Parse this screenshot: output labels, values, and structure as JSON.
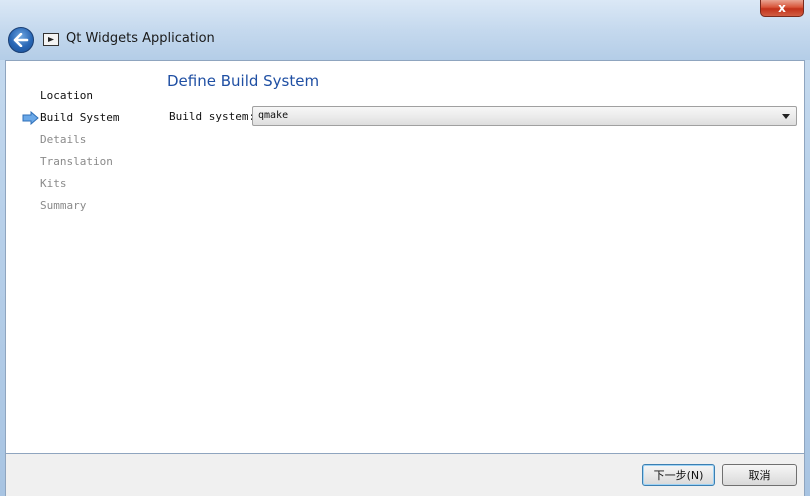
{
  "window": {
    "title": "Qt Widgets Application",
    "close_label": "x"
  },
  "wizard": {
    "steps": [
      {
        "label": "Location",
        "state": "done"
      },
      {
        "label": "Build System",
        "state": "current"
      },
      {
        "label": "Details",
        "state": "pending"
      },
      {
        "label": "Translation",
        "state": "pending"
      },
      {
        "label": "Kits",
        "state": "pending"
      },
      {
        "label": "Summary",
        "state": "pending"
      }
    ],
    "page_heading": "Define Build System",
    "build_system_label": "Build system:",
    "build_system_value": "qmake"
  },
  "footer": {
    "next_label": "下一步(N)",
    "cancel_label": "取消"
  },
  "colors": {
    "heading": "#1f4fa3",
    "current_step_arrow": "#4a8fdc"
  }
}
